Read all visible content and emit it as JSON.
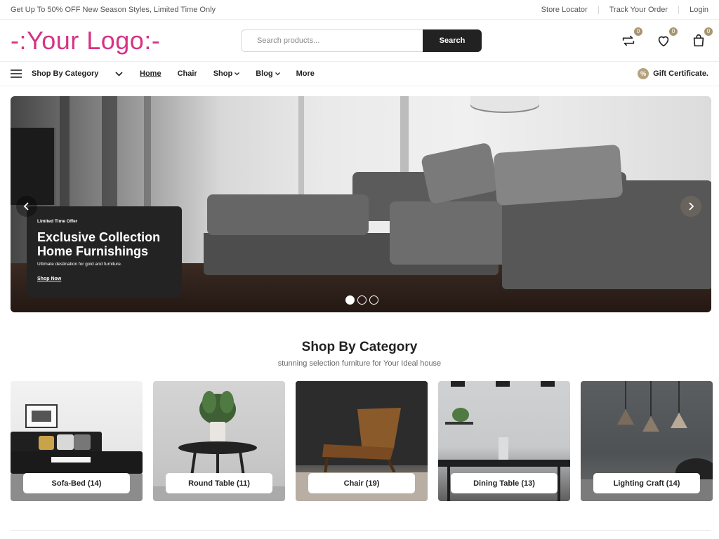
{
  "topbar": {
    "promo": "Get Up To 50% OFF New Season Styles, Limited Time Only",
    "links": [
      "Store Locator",
      "Track Your Order",
      "Login"
    ]
  },
  "header": {
    "logo": "-:Your Logo:-",
    "search_placeholder": "Search products...",
    "search_button": "Search",
    "compare_count": "0",
    "wishlist_count": "0",
    "cart_count": "0"
  },
  "nav": {
    "category_toggle": "Shop By Category",
    "items": [
      {
        "label": "Home",
        "active": true
      },
      {
        "label": "Chair"
      },
      {
        "label": "Shop",
        "has_dropdown": true
      },
      {
        "label": "Blog",
        "has_dropdown": true
      },
      {
        "label": "More"
      }
    ],
    "gift": "Gift Certificate.",
    "gift_badge": "%"
  },
  "hero": {
    "kicker": "Limited Time Offer",
    "title_line1": "Exclusive Collection",
    "title_line2": "Home Furnishings",
    "subtitle": "Ultimate destination for gold and furniture.",
    "cta": "Shop Now",
    "slide_count": 3,
    "active_slide": 1
  },
  "categories": {
    "title": "Shop By Category",
    "subtitle": "stunning selection furniture for Your Ideal house",
    "items": [
      {
        "label": "Sofa-Bed (14)"
      },
      {
        "label": "Round Table (11)"
      },
      {
        "label": "Chair (19)"
      },
      {
        "label": "Dining Table (13)"
      },
      {
        "label": "Lighting Craft (14)"
      }
    ]
  },
  "colors": {
    "logo": "#d63384",
    "accent": "#a89672",
    "dark": "#222222"
  },
  "icons": [
    "menu-icon",
    "chevron-down-icon",
    "compare-icon",
    "heart-icon",
    "bag-icon",
    "arrow-left-icon",
    "arrow-right-icon",
    "percent-icon"
  ]
}
